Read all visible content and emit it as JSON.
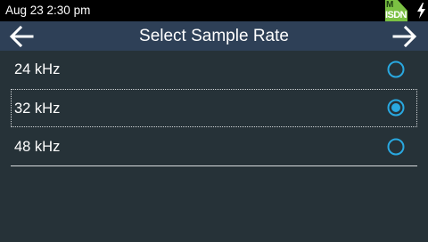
{
  "status_bar": {
    "datetime": "Aug 23 2:30 pm",
    "badge_top": "M",
    "badge_bottom": "ISDN",
    "badge_color": "#7bc143",
    "power_icon": "lightning-bolt-icon"
  },
  "header": {
    "title": "Select Sample Rate",
    "back_icon": "arrow-left-icon",
    "next_icon": "arrow-right-icon",
    "background": "#2e4057"
  },
  "options": [
    {
      "label": "24 kHz",
      "selected": false
    },
    {
      "label": "32 kHz",
      "selected": true,
      "focused": true
    },
    {
      "label": "48 kHz",
      "selected": false
    }
  ],
  "colors": {
    "background": "#263238",
    "radio_accent": "#29a8e0",
    "text": "#ffffff"
  }
}
